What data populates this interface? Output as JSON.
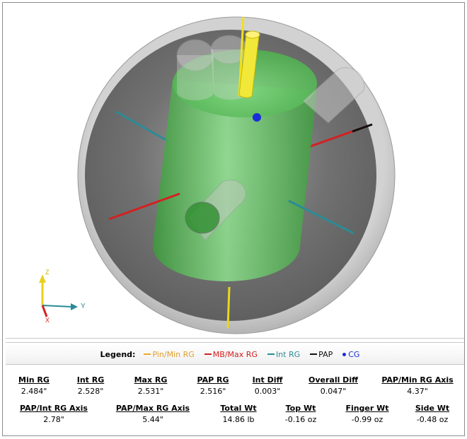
{
  "viewport": {
    "axes": {
      "z_label": "Z",
      "y_label": "Y",
      "x_label": "X"
    }
  },
  "legend": {
    "title": "Legend:",
    "items": [
      {
        "label": "Pin/Min RG",
        "color": "#f0a830",
        "marker": "line"
      },
      {
        "label": "MB/Max RG",
        "color": "#d42020",
        "marker": "line"
      },
      {
        "label": "Int RG",
        "color": "#2a8c96",
        "marker": "line"
      },
      {
        "label": "PAP",
        "color": "#111111",
        "marker": "line"
      },
      {
        "label": "CG",
        "color": "#1a2ed8",
        "marker": "dot"
      }
    ]
  },
  "stats": {
    "row1": [
      {
        "key": "Min RG",
        "value": "2.484\""
      },
      {
        "key": "Int RG",
        "value": "2.528\""
      },
      {
        "key": "Max RG",
        "value": "2.531\""
      },
      {
        "key": "PAP RG",
        "value": "2.516\""
      },
      {
        "key": "Int Diff",
        "value": "0.003\""
      },
      {
        "key": "Overall Diff",
        "value": "0.047\""
      },
      {
        "key": "PAP/Min RG Axis",
        "value": "4.37\""
      }
    ],
    "row2": [
      {
        "key": "PAP/Int RG Axis",
        "value": "2.78\""
      },
      {
        "key": "PAP/Max RG Axis",
        "value": "5.44\""
      },
      {
        "key": "Total Wt",
        "value": "14.86 lb"
      },
      {
        "key": "Top Wt",
        "value": "-0.16 oz"
      },
      {
        "key": "Finger Wt",
        "value": "-0.99 oz"
      },
      {
        "key": "Side Wt",
        "value": "-0.48 oz"
      }
    ]
  }
}
